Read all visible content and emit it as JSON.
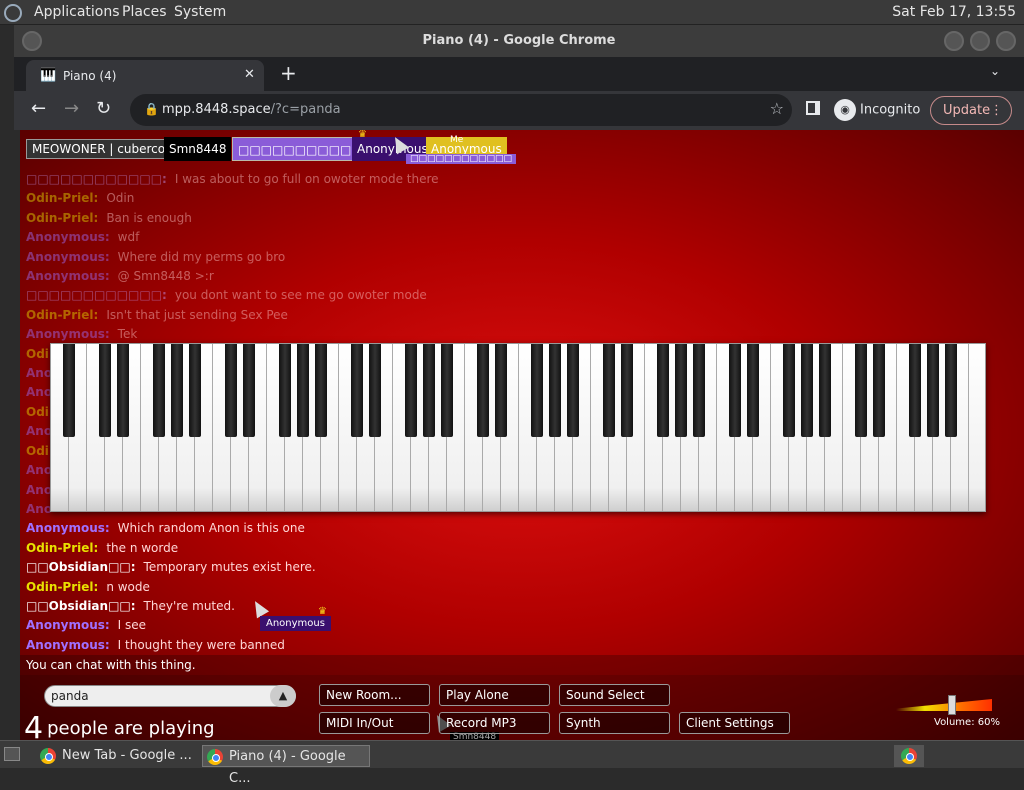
{
  "topbar": {
    "menus": [
      "Applications",
      "Places",
      "System"
    ],
    "clock": "Sat Feb 17, 13:55"
  },
  "window": {
    "title": "Piano (4) - Google Chrome"
  },
  "tab": {
    "title": "Piano (4)",
    "close": "✕",
    "new_tab": "+",
    "menu": "⌄"
  },
  "toolbar": {
    "url_host": "mpp.8448.space",
    "url_query": "/?c=panda",
    "incognito": "Incognito",
    "update": "Update"
  },
  "users": [
    {
      "name": "MEOWONER | cubercoder_",
      "color": "#333333"
    },
    {
      "name": "Smn8448",
      "color": "#000000"
    },
    {
      "name": "□□□□□□□□□□□□",
      "color": "#8a5cd8"
    },
    {
      "name": "Anonymous",
      "color": "#3a0f6e",
      "crown": true
    },
    {
      "name": "Anonymous",
      "color": "#e0c020",
      "me": "Me"
    }
  ],
  "chat": [
    {
      "name": "□□□□□□□□□□□□:",
      "msg": "I was about to go full on owoter mode there",
      "color": "#c8a0ff"
    },
    {
      "name": "Odin-Priel:",
      "msg": "Odin",
      "color": "#e8e000"
    },
    {
      "name": "Odin-Priel:",
      "msg": "Ban is enough",
      "color": "#e8e000"
    },
    {
      "name": "Anonymous:",
      "msg": "wdf",
      "color": "#a070ff"
    },
    {
      "name": "Anonymous:",
      "msg": "Where did my perms go bro",
      "color": "#a070ff"
    },
    {
      "name": "Anonymous:",
      "msg": "@ Smn8448 >:r",
      "color": "#a070ff"
    },
    {
      "name": "□□□□□□□□□□□□:",
      "msg": "you dont want to see me go owoter mode",
      "color": "#c8a0ff"
    },
    {
      "name": "Odin-Priel:",
      "msg": "Isn't that just sending Sex Pee",
      "color": "#e8e000"
    },
    {
      "name": "Anonymous:",
      "msg": "Tek",
      "color": "#a070ff"
    },
    {
      "name": "Odi",
      "msg": "",
      "color": "#e8e000"
    },
    {
      "name": "Ano",
      "msg": "",
      "color": "#a070ff"
    },
    {
      "name": "Ano",
      "msg": "",
      "color": "#a070ff"
    },
    {
      "name": "Odi",
      "msg": "",
      "color": "#e8e000"
    },
    {
      "name": "Ano",
      "msg": "",
      "color": "#a070ff"
    },
    {
      "name": "Odi",
      "msg": "",
      "color": "#e8e000"
    },
    {
      "name": "Ano",
      "msg": "",
      "color": "#a070ff"
    },
    {
      "name": "Ano",
      "msg": "",
      "color": "#a070ff"
    },
    {
      "name": "Ano",
      "msg": "",
      "color": "#a070ff"
    },
    {
      "name": "Anonymous:",
      "msg": "Which random Anon is this one",
      "color": "#a070ff",
      "visible": true
    },
    {
      "name": "Odin-Priel:",
      "msg": "the n worde",
      "color": "#e8e000",
      "visible": true
    },
    {
      "name": "□□Obsidian□□:",
      "msg": "Temporary mutes exist here.",
      "color": "#ffffff",
      "visible": true
    },
    {
      "name": "Odin-Priel:",
      "msg": "n wode",
      "color": "#e8e000",
      "visible": true
    },
    {
      "name": "□□Obsidian□□:",
      "msg": "They're muted.",
      "color": "#ffffff",
      "visible": true
    },
    {
      "name": "Anonymous:",
      "msg": "I see",
      "color": "#a070ff",
      "visible": true
    },
    {
      "name": "Anonymous:",
      "msg": "I thought they were banned",
      "color": "#a070ff",
      "visible": true
    }
  ],
  "cursor_tags": {
    "anon": "Anonymous",
    "smn": "Smn8448"
  },
  "chat_info": "You can chat with this thing.",
  "room": {
    "value": "panda",
    "arrow": "▲"
  },
  "players": {
    "count": "4",
    "label": "people are playing"
  },
  "buttons": {
    "new_room": "New Room...",
    "play_alone": "Play Alone",
    "sound_select": "Sound Select",
    "midi": "MIDI In/Out",
    "record": "Record MP3",
    "synth": "Synth",
    "client_settings": "Client Settings"
  },
  "volume": {
    "label": "Volume: 60%",
    "level": 0.6
  },
  "taskbar": {
    "items": [
      "New Tab - Google ...",
      "Piano (4) - Google C..."
    ]
  }
}
